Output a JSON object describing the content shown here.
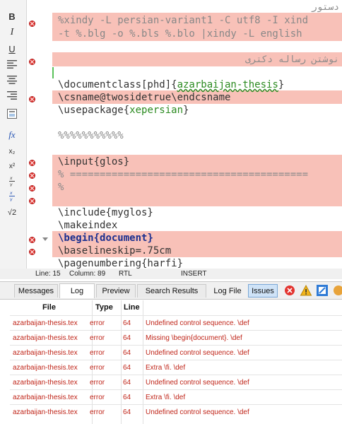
{
  "editor": {
    "lines": [
      {
        "rtl": "دستور"
      },
      {
        "text": "%xindy -L persian-variant1 -C utf8 -I xind"
      },
      {
        "text": "-t %.blg -o %.bls %.blo |xindy -L english"
      },
      {
        "rtl": "نوشتن رساله دکتری"
      },
      {
        "pre": "\\documentclass[phd]{",
        "link": "azarbaijan-thesis",
        "post": "}"
      },
      {
        "text": "\\csname@twosidetrue\\endcsname"
      },
      {
        "pre": "\\usepackage{",
        "green": "xepersian",
        "post": "}"
      },
      {
        "text": "%%%%%%%%%%%"
      },
      {
        "text": "\\input{glos}"
      },
      {
        "text": "% ========================================"
      },
      {
        "text": "%"
      },
      {
        "text": "\\include{myglos}"
      },
      {
        "text": "\\makeindex"
      },
      {
        "pre": "\\begin{",
        "navy": "document",
        "post": "}"
      },
      {
        "text": "\\baselineskip=.75cm"
      },
      {
        "text": "\\pagenumbering{harfi}"
      }
    ]
  },
  "status": {
    "line": "Line: 15",
    "column": "Column: 89",
    "direction": "RTL",
    "mode": "INSERT"
  },
  "tabs": {
    "messages": "Messages",
    "log": "Log",
    "preview": "Preview",
    "search_results": "Search Results",
    "log_file": "Log File",
    "issues": "Issues"
  },
  "log_table": {
    "headers": {
      "file": "File",
      "type": "Type",
      "line": "Line"
    },
    "rows": [
      {
        "file": "azarbaijan-thesis.tex",
        "type": "error",
        "line": "64",
        "message": "Undefined control sequence. \\def"
      },
      {
        "file": "azarbaijan-thesis.tex",
        "type": "error",
        "line": "64",
        "message": "Missing \\begin{document}. \\def"
      },
      {
        "file": "azarbaijan-thesis.tex",
        "type": "error",
        "line": "64",
        "message": "Undefined control sequence. \\def"
      },
      {
        "file": "azarbaijan-thesis.tex",
        "type": "error",
        "line": "64",
        "message": "Extra \\fi. \\def"
      },
      {
        "file": "azarbaijan-thesis.tex",
        "type": "error",
        "line": "64",
        "message": "Undefined control sequence. \\def"
      },
      {
        "file": "azarbaijan-thesis.tex",
        "type": "error",
        "line": "64",
        "message": "Extra \\fi. \\def"
      },
      {
        "file": "azarbaijan-thesis.tex",
        "type": "error",
        "line": "64",
        "message": "Undefined control sequence. \\def"
      }
    ]
  },
  "toolbar": {
    "bold": "B",
    "italic": "I",
    "underline": "U",
    "subscript": "x₂",
    "superscript": "x²",
    "fx": "fx",
    "sqrt": "√2"
  },
  "colors": {
    "error_highlight": "#f8c1b8",
    "error_text": "#c0261a",
    "code_green": "#2a8a1f",
    "keyword_navy": "#1b2f8f"
  }
}
